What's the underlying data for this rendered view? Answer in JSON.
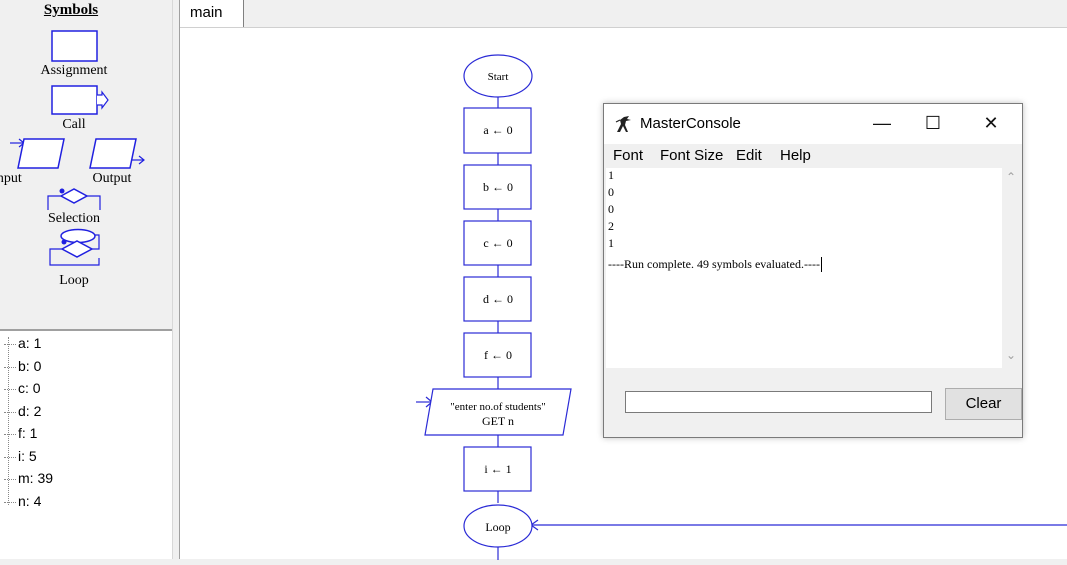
{
  "symbols": {
    "title": "Symbols",
    "assignment": "Assignment",
    "call": "Call",
    "input": "Input",
    "output": "Output",
    "selection": "Selection",
    "loop": "Loop"
  },
  "variables": [
    {
      "text": "a: 1"
    },
    {
      "text": "b: 0"
    },
    {
      "text": "c: 0"
    },
    {
      "text": "d: 2"
    },
    {
      "text": "f: 1"
    },
    {
      "text": "i: 5"
    },
    {
      "text": "m: 39"
    },
    {
      "text": "n: 4"
    }
  ],
  "tabs": [
    {
      "label": "main"
    }
  ],
  "flowchart": {
    "start": "Start",
    "steps": [
      "a ← 0",
      "b ← 0",
      "c ← 0",
      "d ← 0",
      "f ← 0"
    ],
    "input_prompt": "\"enter no.of students\"",
    "input_get": "GET n",
    "step_i": "i ← 1",
    "loop": "Loop",
    "shape_color": "#2b2bd6"
  },
  "console": {
    "title": "MasterConsole",
    "minimize": "—",
    "maximize": "☐",
    "close": "✕",
    "menu": [
      "Font",
      "Font Size",
      "Edit",
      "Help"
    ],
    "output_lines": [
      "1",
      "0",
      "0",
      "2",
      "1",
      "----Run complete.  49 symbols evaluated.----"
    ],
    "input_value": "",
    "clear_label": "Clear",
    "scroll_up": "⌃",
    "scroll_down": "⌄"
  }
}
